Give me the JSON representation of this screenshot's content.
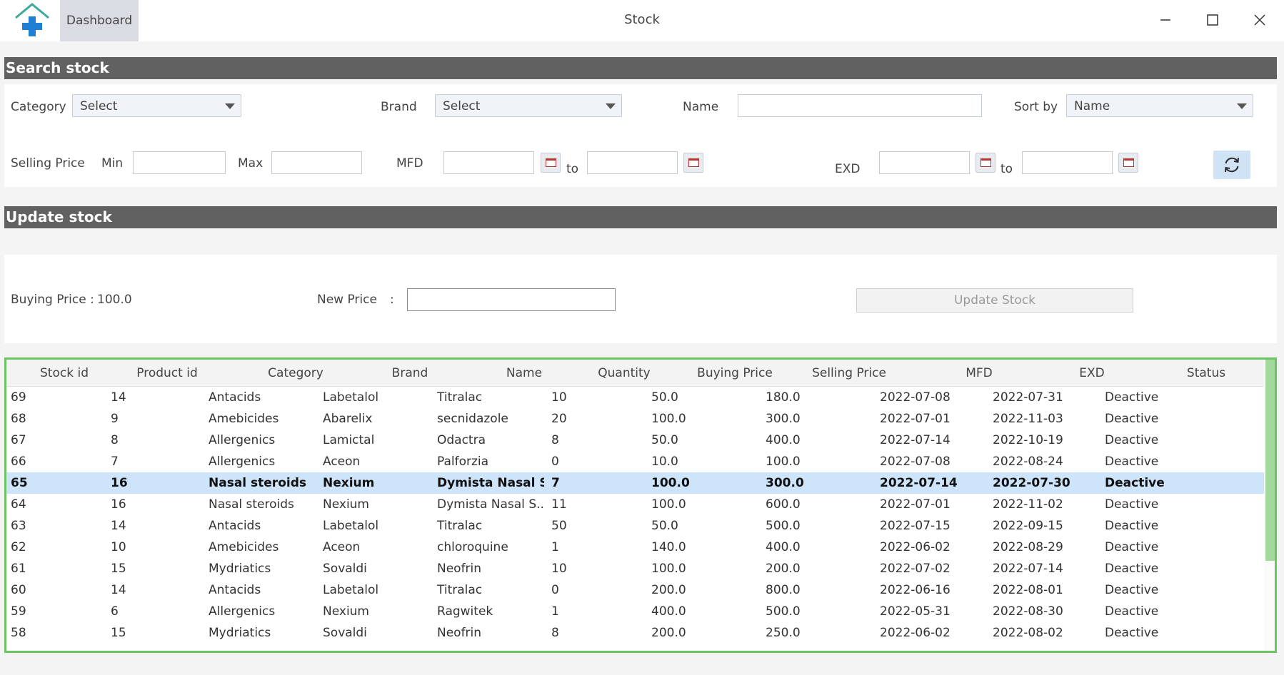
{
  "window": {
    "title": "Stock",
    "dashboard_label": "Dashboard"
  },
  "search_section": {
    "title": "Search stock",
    "category_label": "Category",
    "category_value": "Select",
    "brand_label": "Brand",
    "brand_value": "Select",
    "name_label": "Name",
    "name_value": "",
    "sortby_label": "Sort by",
    "sortby_value": "Name",
    "selling_price_label": "Selling Price",
    "min_label": "Min",
    "max_label": "Max",
    "mfd_label": "MFD",
    "exd_label": "EXD",
    "to_label": "to"
  },
  "update_section": {
    "title": "Update stock",
    "buying_price_label": "Buying Price :",
    "buying_price_value": "100.0",
    "new_price_label": "New Price",
    "colon": ":",
    "new_price_value": "",
    "update_button_label": "Update Stock"
  },
  "table": {
    "columns": [
      "Stock id",
      "Product id",
      "Category",
      "Brand",
      "Name",
      "Quantity",
      "Buying Price",
      "Selling Price",
      "MFD",
      "EXD",
      "Status"
    ],
    "selected_stock_id": "65",
    "rows": [
      [
        "69",
        "14",
        "Antacids",
        "Labetalol",
        "Titralac",
        "10",
        "50.0",
        "180.0",
        "2022-07-08",
        "2022-07-31",
        "Deactive"
      ],
      [
        "68",
        "9",
        "Amebicides",
        "Abarelix",
        "secnidazole",
        "20",
        "100.0",
        "300.0",
        "2022-07-01",
        "2022-11-03",
        "Deactive"
      ],
      [
        "67",
        "8",
        "Allergenics",
        "Lamictal",
        "Odactra",
        "8",
        "50.0",
        "400.0",
        "2022-07-14",
        "2022-10-19",
        "Deactive"
      ],
      [
        "66",
        "7",
        "Allergenics",
        "Aceon",
        "Palforzia",
        "0",
        "10.0",
        "100.0",
        "2022-07-08",
        "2022-08-24",
        "Deactive"
      ],
      [
        "65",
        "16",
        "Nasal steroids",
        "Nexium",
        "Dymista Nasal S...",
        "7",
        "100.0",
        "300.0",
        "2022-07-14",
        "2022-07-30",
        "Deactive"
      ],
      [
        "64",
        "16",
        "Nasal steroids",
        "Nexium",
        "Dymista Nasal S...",
        "11",
        "100.0",
        "600.0",
        "2022-07-01",
        "2022-11-02",
        "Deactive"
      ],
      [
        "63",
        "14",
        "Antacids",
        "Labetalol",
        "Titralac",
        "50",
        "50.0",
        "500.0",
        "2022-07-15",
        "2022-09-15",
        "Deactive"
      ],
      [
        "62",
        "10",
        "Amebicides",
        "Aceon",
        "chloroquine",
        "1",
        "140.0",
        "400.0",
        "2022-06-02",
        "2022-08-29",
        "Deactive"
      ],
      [
        "61",
        "15",
        "Mydriatics",
        "Sovaldi",
        "Neofrin",
        "10",
        "100.0",
        "200.0",
        "2022-07-02",
        "2022-07-14",
        "Deactive"
      ],
      [
        "60",
        "14",
        "Antacids",
        "Labetalol",
        "Titralac",
        "0",
        "200.0",
        "800.0",
        "2022-06-16",
        "2022-08-01",
        "Deactive"
      ],
      [
        "59",
        "6",
        "Allergenics",
        "Nexium",
        "Ragwitek",
        "1",
        "400.0",
        "500.0",
        "2022-05-31",
        "2022-08-30",
        "Deactive"
      ],
      [
        "58",
        "15",
        "Mydriatics",
        "Sovaldi",
        "Neofrin",
        "8",
        "200.0",
        "250.0",
        "2022-06-02",
        "2022-08-02",
        "Deactive"
      ]
    ]
  },
  "colors": {
    "section_bar": "#616161",
    "table_border": "#6cc464",
    "selected_row": "#cde4fb"
  },
  "icons": [
    "home-medical-logo-icon",
    "minimize-icon",
    "maximize-icon",
    "close-icon",
    "calendar-icon",
    "refresh-icon",
    "chevron-down-icon"
  ]
}
